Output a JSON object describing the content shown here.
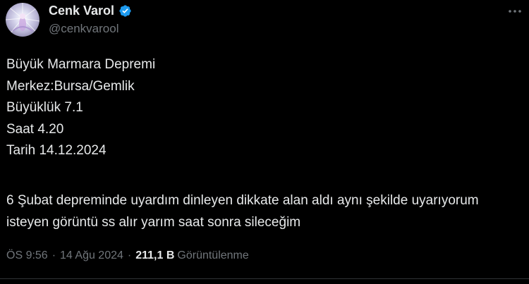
{
  "author": {
    "display_name": "Cenk Varol",
    "handle": "@cenkvarool",
    "verified_icon": "verified-badge-icon",
    "avatar": "avatar-image"
  },
  "tweet": {
    "lines": [
      "Büyük Marmara Depremi",
      "Merkez:Bursa/Gemlik",
      "Büyüklük 7.1",
      "Saat 4.20",
      "Tarih 14.12.2024"
    ],
    "paragraph": "6 Şubat depreminde uyardım dinleyen dikkate alan aldı aynı şekilde uyarıyorum isteyen görüntü ss alır yarım saat sonra sileceğim"
  },
  "meta": {
    "time": "ÖS 9:56",
    "separator": "·",
    "date": "14 Ağu 2024",
    "views_count": "211,1 B",
    "views_label": "Görüntülenme"
  },
  "colors": {
    "background": "#000000",
    "text_primary": "#e7e9ea",
    "text_secondary": "#71767b",
    "verified": "#1d9bf0",
    "divider": "#2f3336"
  }
}
